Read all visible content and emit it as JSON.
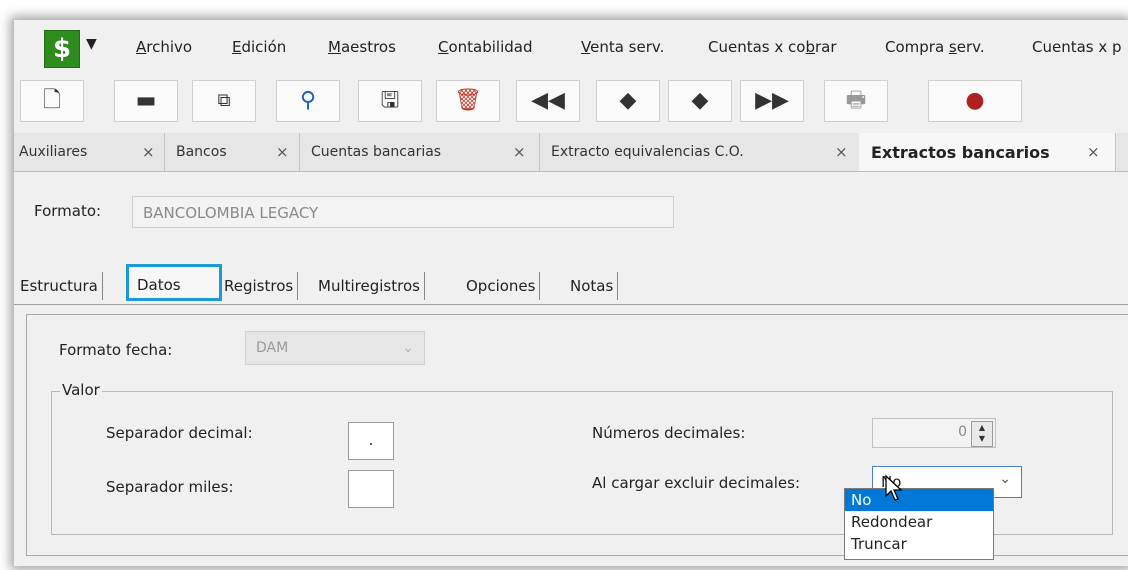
{
  "app": {
    "logo_symbol": "$",
    "accent": "#2e8b1e"
  },
  "menu": [
    {
      "u": "A",
      "rest": "rchivo"
    },
    {
      "u": "E",
      "rest": "dición"
    },
    {
      "u": "M",
      "rest": "aestros"
    },
    {
      "u": "C",
      "rest": "ontabilidad"
    },
    {
      "u": "V",
      "rest": "enta serv."
    },
    {
      "pre": "Cuentas x co",
      "u": "b",
      "rest": "rar"
    },
    {
      "pre": "Compra ",
      "u": "s",
      "rest": "erv."
    },
    {
      "pre": "Cuentas x p",
      "u": "",
      "rest": ""
    }
  ],
  "toolbar": {
    "icons": [
      "new-document-icon",
      "open-folder-icon",
      "copy-icon",
      "search-icon",
      "save-icon",
      "delete-icon",
      "first-record-icon",
      "previous-record-icon",
      "next-record-icon",
      "last-record-icon",
      "print-icon",
      "help-icon"
    ]
  },
  "doc_tabs": [
    {
      "label": "Auxiliares",
      "close": "×"
    },
    {
      "label": "Bancos",
      "close": "×"
    },
    {
      "label": "Cuentas bancarias",
      "close": "×"
    },
    {
      "label": "Extracto equivalencias C.O.",
      "close": "×"
    },
    {
      "label": "Extractos bancarios",
      "close": "×",
      "active": true
    }
  ],
  "form": {
    "formato_label": "Formato:",
    "formato_value": "BANCOLOMBIA LEGACY",
    "tabs": [
      "Estructura",
      "Datos",
      "Registros",
      "Multiregistros",
      "Opciones",
      "Notas"
    ],
    "active_tab": "Datos",
    "highlight_color": "#1a9ad6",
    "fecha_label": "Formato fecha:",
    "fecha_value": "DAM",
    "valor_group": "Valor",
    "sep_decimal_label": "Separador decimal:",
    "sep_decimal_value": ".",
    "sep_miles_label": "Separador miles:",
    "sep_miles_value": "",
    "num_decimales_label": "Números decimales:",
    "num_decimales_value": "0",
    "excluir_label": "Al cargar excluir decimales:",
    "excluir_value": "No",
    "excluir_options": [
      "No",
      "Redondear",
      "Truncar"
    ],
    "excluir_selected_index": 0
  }
}
